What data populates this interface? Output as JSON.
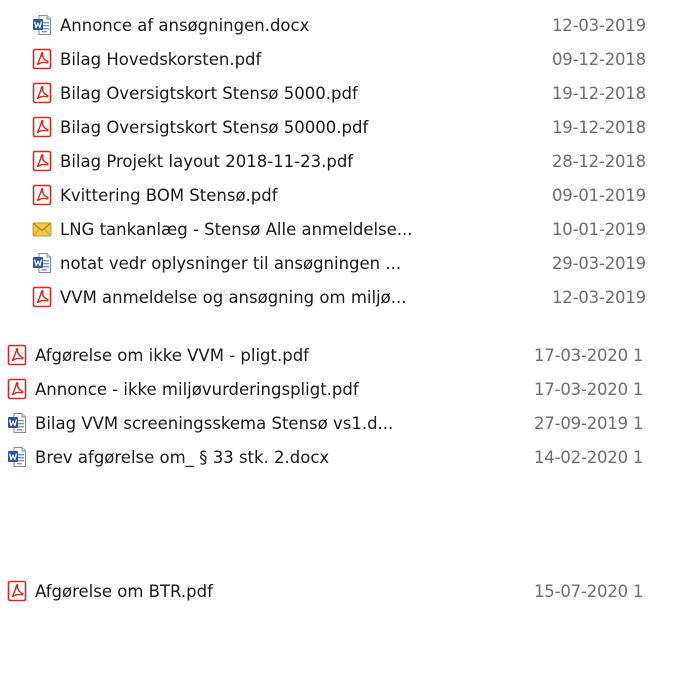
{
  "files": [
    {
      "name": "Annonce af ansøgningen.docx",
      "date": "12-03-2019",
      "icon": "word-icon"
    },
    {
      "name": "Bilag Hovedskorsten.pdf",
      "date": "09-12-2018",
      "icon": "pdf-icon"
    },
    {
      "name": "Bilag Oversigtskort Stensø 5000.pdf",
      "date": "19-12-2018",
      "icon": "pdf-icon"
    },
    {
      "name": "Bilag Oversigtskort Stensø 50000.pdf",
      "date": "19-12-2018",
      "icon": "pdf-icon"
    },
    {
      "name": "Bilag Projekt layout 2018-11-23.pdf",
      "date": "28-12-2018",
      "icon": "pdf-icon"
    },
    {
      "name": "Kvittering BOM Stensø.pdf",
      "date": "09-01-2019",
      "icon": "pdf-icon"
    },
    {
      "name": "LNG tankanlæg - Stensø Alle anmeldelse...",
      "date": "10-01-2019",
      "icon": "mail-icon"
    },
    {
      "name": "notat vedr oplysninger til ansøgningen ...",
      "date": "29-03-2019",
      "icon": "word-icon"
    },
    {
      "name": "VVM anmeldelse og ansøgning om miljø...",
      "date": "12-03-2019",
      "icon": "pdf-icon"
    },
    {
      "name": "Afgørelse om ikke VVM - pligt.pdf",
      "date": "17-03-2020 1",
      "icon": "pdf-icon"
    },
    {
      "name": "Annonce - ikke miljøvurderingspligt.pdf",
      "date": "17-03-2020 1",
      "icon": "pdf-icon"
    },
    {
      "name": "Bilag VVM screeningsskema Stensø vs1.d...",
      "date": "27-09-2019 1",
      "icon": "word-icon"
    },
    {
      "name": "Brev afgørelse om_ § 33 stk. 2.docx",
      "date": "14-02-2020 1",
      "icon": "word-icon"
    },
    {
      "name": "Afgørelse om BTR.pdf",
      "date": "15-07-2020 1",
      "icon": "pdf-icon"
    }
  ],
  "colors": {
    "pdf_red": "#d42a20",
    "word_blue": "#2b5797",
    "mail_yellow": "#f2c94c",
    "date_gray": "#6e6e6e"
  }
}
